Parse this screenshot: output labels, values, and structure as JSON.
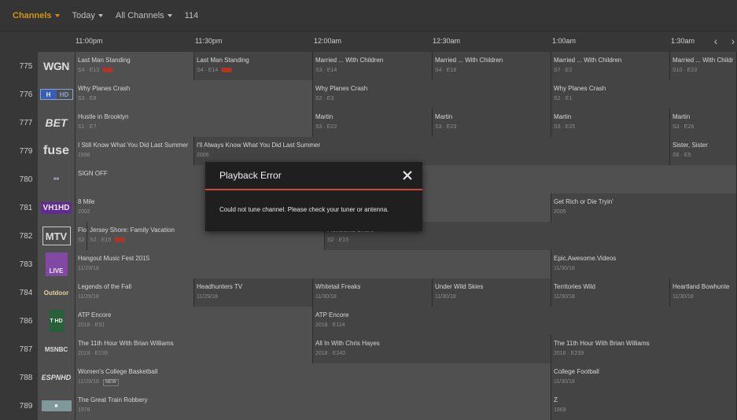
{
  "topbar": {
    "channels_label": "Channels",
    "day_label": "Today",
    "filter_label": "All Channels",
    "count": "114"
  },
  "timeline": {
    "times": [
      "11:00pm",
      "11:30pm",
      "12:00am",
      "12:30am",
      "1:00am",
      "1:30am"
    ],
    "prev_icon": "chevron-left-icon",
    "next_icon": "chevron-right-icon"
  },
  "rows": [
    {
      "num": "775",
      "logo": "WGN",
      "programs": [
        {
          "title": "Last Man Standing",
          "sub": "S4 · E13",
          "rec": true
        },
        {
          "title": "Last Man Standing",
          "sub": "S4 · E14",
          "rec": true
        },
        {
          "title": "Married ... With Children",
          "sub": "S3 · E14"
        },
        {
          "title": "Married ... With Children",
          "sub": "S4 · E18"
        },
        {
          "title": "Married ... With Children",
          "sub": "S7 · E2"
        },
        {
          "title": "Married ... With Childr",
          "sub": "S10 · E23"
        }
      ]
    },
    {
      "num": "776",
      "logo": "HD",
      "programs": [
        {
          "title": "Why Planes Crash",
          "sub": "S3 · E8"
        },
        {
          "title": "Why Planes Crash",
          "sub": "S2 · E3"
        },
        {
          "title": "Why Planes Crash",
          "sub": "S2 · E1"
        }
      ]
    },
    {
      "num": "777",
      "logo": "BET",
      "programs": [
        {
          "title": "Hustle in Brooklyn",
          "sub": "S1 · E7"
        },
        {
          "title": "Martin",
          "sub": "S3 · E22"
        },
        {
          "title": "Martin",
          "sub": "S3 · E23"
        },
        {
          "title": "Martin",
          "sub": "S3 · E25"
        },
        {
          "title": "Martin",
          "sub": "S3 · E26"
        }
      ]
    },
    {
      "num": "779",
      "logo": "fuse",
      "programs": [
        {
          "title": "I Still Know What You Did Last Summer",
          "sub": "1998"
        },
        {
          "title": "I'll Always Know What You Did Last Summer",
          "sub": "2006"
        },
        {
          "title": "Sister, Sister",
          "sub": "S6 · E5"
        }
      ]
    },
    {
      "num": "780",
      "logo": "",
      "programs": [
        {
          "title": "SIGN OFF",
          "sub": ""
        }
      ]
    },
    {
      "num": "781",
      "logo": "VH1HD",
      "programs": [
        {
          "title": "8 Mile",
          "sub": "2002"
        },
        {
          "title": "Get Rich or Die Tryin'",
          "sub": "2005"
        }
      ]
    },
    {
      "num": "782",
      "logo": "MTV",
      "programs": [
        {
          "title": "Flo",
          "sub": "S2"
        },
        {
          "title": "Jersey Shore: Family Vacation",
          "sub": "S2 · E15",
          "rec": true
        },
        {
          "title": "Floribama Shore",
          "sub": "S2 · E15"
        }
      ]
    },
    {
      "num": "783",
      "logo": "LIVE",
      "programs": [
        {
          "title": "Hangout Music Fest 2015",
          "sub": "11/29/18"
        },
        {
          "title": "Epic.Awesome.Videos",
          "sub": "11/30/18"
        }
      ]
    },
    {
      "num": "784",
      "logo": "Outdoor",
      "programs": [
        {
          "title": "Legends of the Fall",
          "sub": "11/29/18"
        },
        {
          "title": "Headhunters TV",
          "sub": "11/29/18"
        },
        {
          "title": "Whitetail Freaks",
          "sub": "11/30/18"
        },
        {
          "title": "Under Wild Skies",
          "sub": "11/30/18"
        },
        {
          "title": "Territories Wild",
          "sub": "11/30/18"
        },
        {
          "title": "Heartland Bowhunte",
          "sub": "11/30/18"
        }
      ]
    },
    {
      "num": "786",
      "logo": "T HD",
      "programs": [
        {
          "title": "ATP Encore",
          "sub": "2018 · E91"
        },
        {
          "title": "ATP Encore",
          "sub": "2018 · E114"
        }
      ]
    },
    {
      "num": "787",
      "logo": "MSNBC",
      "programs": [
        {
          "title": "The 11th Hour With Brian Williams",
          "sub": "2018 · E239"
        },
        {
          "title": "All In With Chris Hayes",
          "sub": "2018 · E240"
        },
        {
          "title": "The 11th Hour With Brian Williams",
          "sub": "2018 · E239"
        }
      ]
    },
    {
      "num": "788",
      "logo": "ESPNHD",
      "programs": [
        {
          "title": "Women's College Basketball",
          "sub": "11/29/18",
          "new": "NEW"
        },
        {
          "title": "College Football",
          "sub": "11/30/18"
        }
      ]
    },
    {
      "num": "789",
      "logo": "",
      "programs": [
        {
          "title": "The Great Train Robbery",
          "sub": "1978"
        },
        {
          "title": "Z",
          "sub": "1969"
        }
      ]
    }
  ],
  "modal": {
    "title": "Playback Error",
    "message": "Could not tune channel. Please check your tuner or antenna.",
    "close_icon": "close-icon"
  },
  "colors": {
    "accent": "#e5a00d",
    "error_rule": "#cc4b37",
    "rec_badge": "#c0392b"
  }
}
